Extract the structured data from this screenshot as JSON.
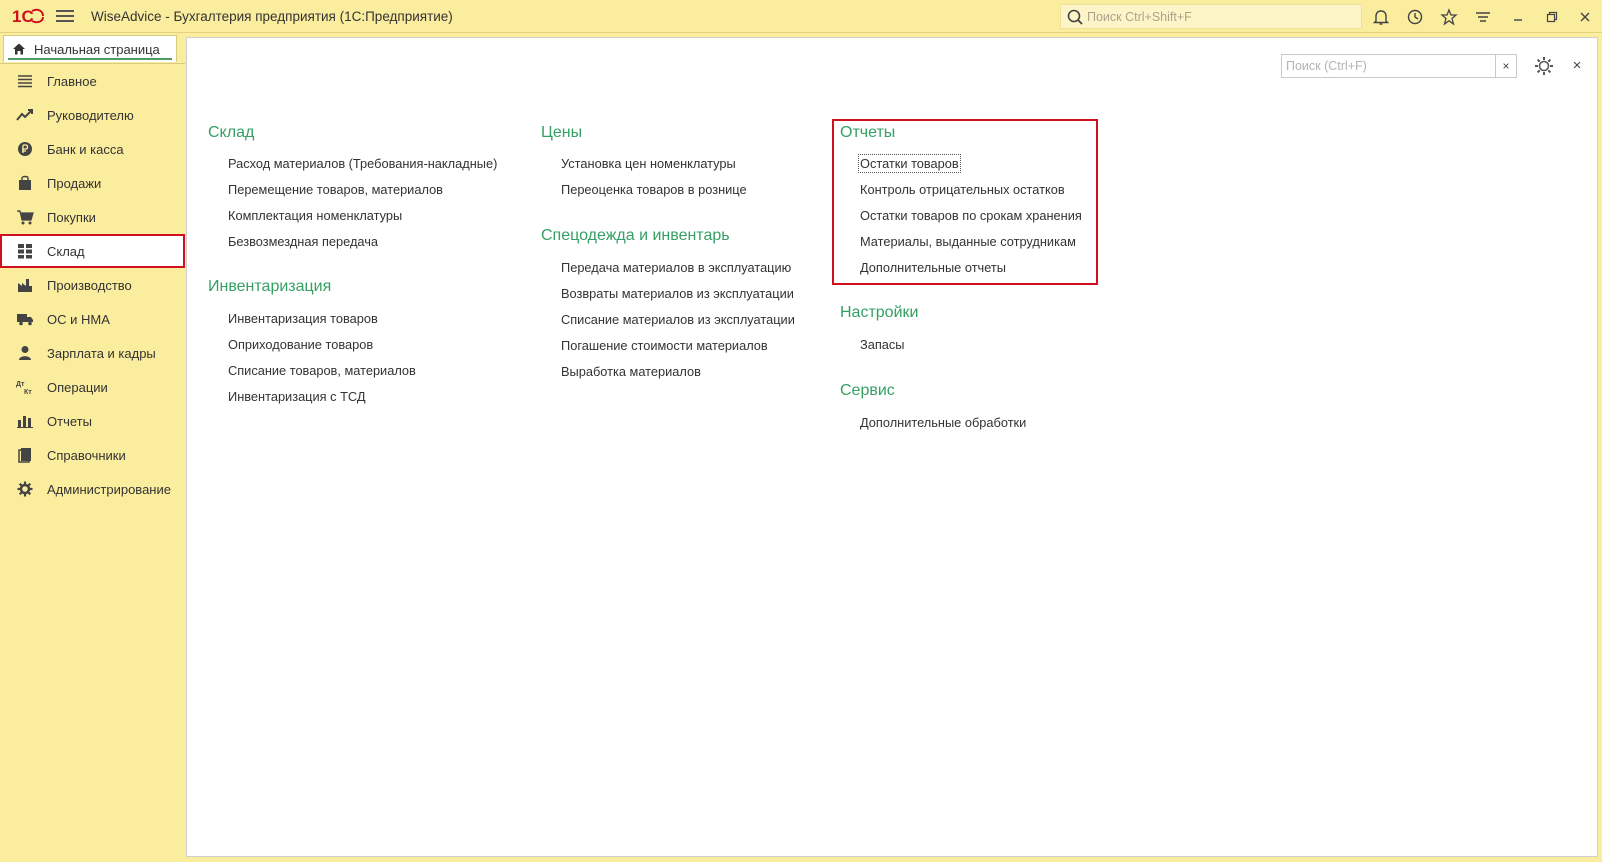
{
  "titlebar": {
    "app_title": "WiseAdvice - Бухгалтерия предприятия  (1С:Предприятие)",
    "search_placeholder": "Поиск Ctrl+Shift+F",
    "icons": [
      "bell-icon",
      "history-icon",
      "star-icon",
      "settings-lines-icon",
      "minimize-icon",
      "restore-icon",
      "close-icon"
    ]
  },
  "tab": {
    "home_label": "Начальная страница"
  },
  "sidebar": {
    "items": [
      {
        "label": "Главное",
        "icon": "menu-lines-icon"
      },
      {
        "label": "Руководителю",
        "icon": "trend-icon"
      },
      {
        "label": "Банк и касса",
        "icon": "ruble-coin-icon"
      },
      {
        "label": "Продажи",
        "icon": "shopping-bag-icon"
      },
      {
        "label": "Покупки",
        "icon": "cart-icon"
      },
      {
        "label": "Склад",
        "icon": "warehouse-grid-icon"
      },
      {
        "label": "Производство",
        "icon": "factory-icon"
      },
      {
        "label": "ОС и НМА",
        "icon": "truck-icon"
      },
      {
        "label": "Зарплата и кадры",
        "icon": "person-icon"
      },
      {
        "label": "Операции",
        "icon": "dt-kt-icon"
      },
      {
        "label": "Отчеты",
        "icon": "bar-chart-icon"
      },
      {
        "label": "Справочники",
        "icon": "book-icon"
      },
      {
        "label": "Администрирование",
        "icon": "gear-icon"
      }
    ],
    "active": "Склад"
  },
  "main": {
    "search_placeholder": "Поиск (Ctrl+F)",
    "clear_label": "×",
    "close_label": "×",
    "groups": {
      "sklad": {
        "title": "Склад",
        "links": [
          "Расход материалов (Требования-накладные)",
          "Перемещение товаров, материалов",
          "Комплектация номенклатуры",
          "Безвозмездная передача"
        ]
      },
      "inventarizaciya": {
        "title": "Инвентаризация",
        "links": [
          "Инвентаризация товаров",
          "Оприходование товаров",
          "Списание товаров, материалов",
          "Инвентаризация с ТСД"
        ]
      },
      "ceny": {
        "title": "Цены",
        "links": [
          "Установка цен номенклатуры",
          "Переоценка товаров в рознице"
        ]
      },
      "specodezhda": {
        "title": "Спецодежда и инвентарь",
        "links": [
          "Передача материалов в эксплуатацию",
          "Возвраты материалов из эксплуатации",
          "Списание материалов из эксплуатации",
          "Погашение стоимости материалов",
          "Выработка материалов"
        ]
      },
      "otchety": {
        "title": "Отчеты",
        "links": [
          "Остатки товаров",
          "Контроль отрицательных остатков",
          "Остатки товаров по срокам хранения",
          "Материалы, выданные сотрудникам",
          "Дополнительные отчеты"
        ]
      },
      "nastroyki": {
        "title": "Настройки",
        "links": [
          "Запасы"
        ]
      },
      "servis": {
        "title": "Сервис",
        "links": [
          "Дополнительные обработки"
        ]
      }
    }
  },
  "colors": {
    "sidebar_bg": "#fbed9e",
    "group_title": "#35a063",
    "highlight_red": "#d0101e"
  }
}
